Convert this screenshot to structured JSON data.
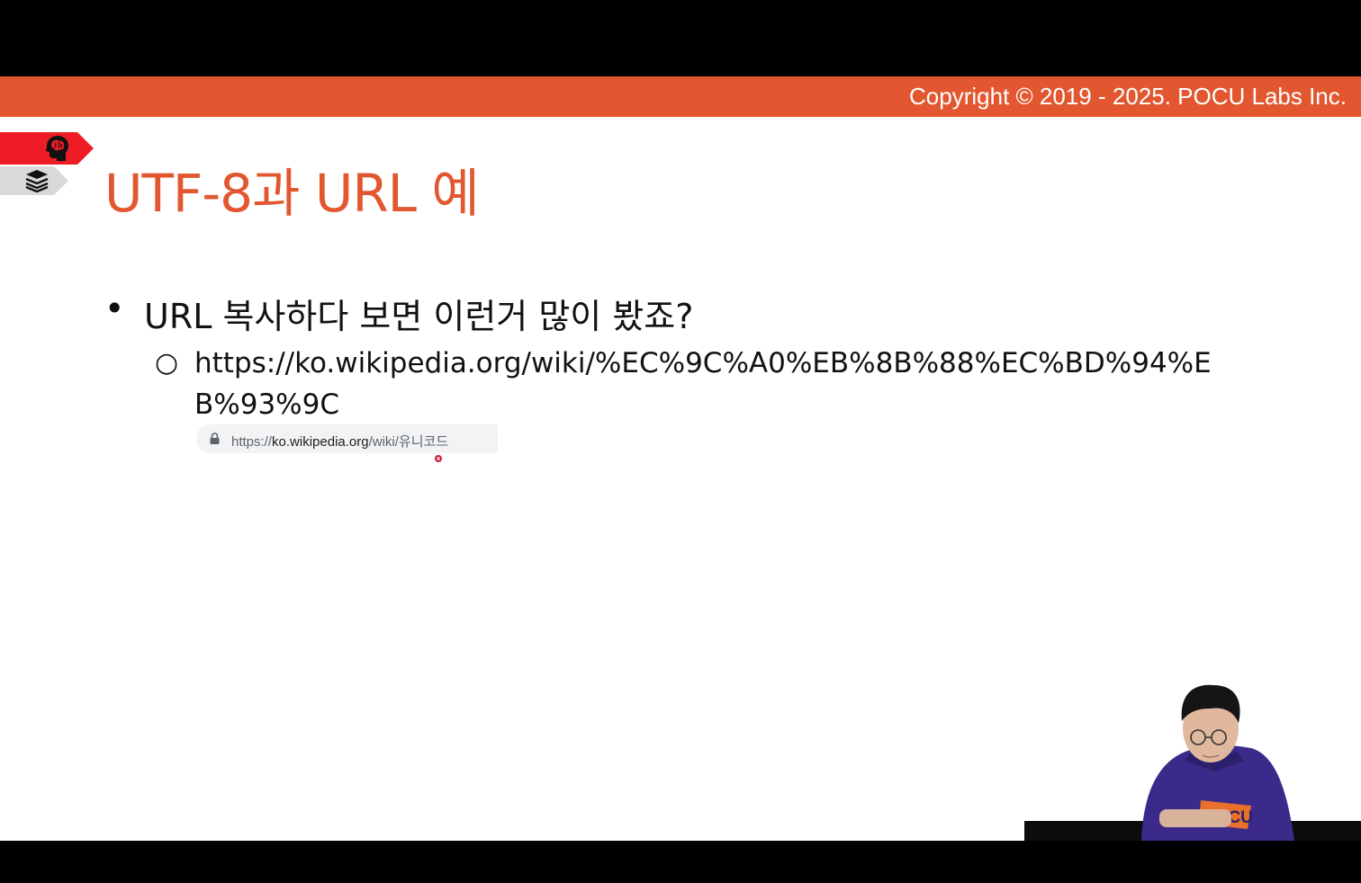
{
  "header": {
    "copyright": "Copyright © 2019 - 2025. POCU Labs Inc.",
    "accent_color": "#e2572f"
  },
  "side_tags": [
    {
      "name": "brain-icon",
      "color": "#ee1c25"
    },
    {
      "name": "book-stack-icon",
      "color": "#d9d9d9"
    }
  ],
  "slide": {
    "title": "UTF-8과 URL 예",
    "bullets": [
      {
        "marker": "•",
        "text": "URL 복사하다 보면 이런거 많이 봤죠?",
        "children": [
          {
            "marker": "○",
            "text": "https://ko.wikipedia.org/wiki/%EC%9C%A0%EB%8B%88%EC%BD%94%EB%93%9C"
          }
        ]
      }
    ]
  },
  "address_bar": {
    "icon": "lock-icon",
    "scheme": "https://",
    "host": "ko.wikipedia.org",
    "path": "/wiki/유니코드"
  },
  "presenter": {
    "shirt_text": "POCU"
  }
}
